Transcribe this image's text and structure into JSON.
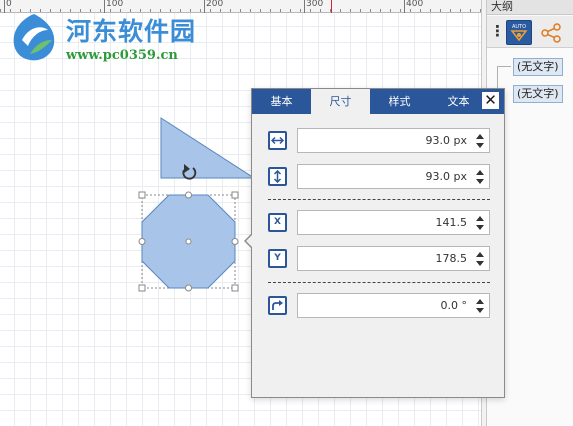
{
  "ruler": {
    "ticks": [
      "0",
      "100",
      "200",
      "300",
      "400"
    ]
  },
  "watermark": {
    "title": "河东软件园",
    "url": "www.pc0359.cn"
  },
  "right_panel": {
    "title": "大纲",
    "outline_items": [
      "(无文字)",
      "(无文字)"
    ],
    "toolbar": {
      "more_icon": "more-vertical-icon",
      "auto_icon": "auto-layout-icon",
      "auto_text": "AUTO",
      "share_icon": "share-icon"
    }
  },
  "properties": {
    "tabs": [
      "基本",
      "尺寸",
      "样式",
      "文本"
    ],
    "active_tab": "尺寸",
    "close_label": "✕",
    "fields": {
      "width": {
        "icon": "width-arrows-icon",
        "value": "93.0 px"
      },
      "height": {
        "icon": "height-arrows-icon",
        "value": "93.0 px"
      },
      "x": {
        "icon_label": "X",
        "value": "141.5"
      },
      "y": {
        "icon_label": "Y",
        "value": "178.5"
      },
      "rotation": {
        "icon": "rotate-arrow-icon",
        "value": "0.0 °"
      }
    }
  },
  "colors": {
    "shape_fill": "#a8c4e8",
    "shape_stroke": "#5a87bf",
    "accent": "#2b579a"
  }
}
